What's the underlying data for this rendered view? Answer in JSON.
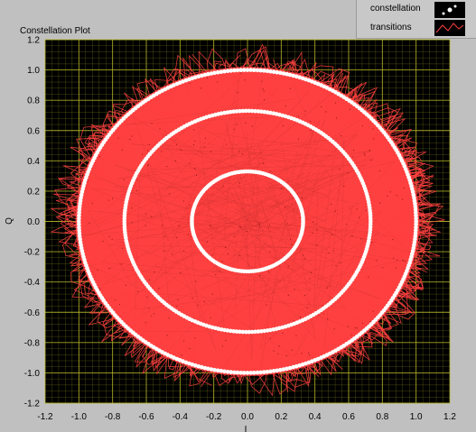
{
  "chart_data": {
    "type": "scatter",
    "title": "Constellation Plot",
    "xlabel": "I",
    "ylabel": "Q",
    "xlim": [
      -1.2,
      1.2
    ],
    "ylim": [
      -1.2,
      1.2
    ],
    "xticks": [
      "-1.2",
      "-1.0",
      "-0.8",
      "-0.6",
      "-0.4",
      "-0.2",
      "0.0",
      "0.2",
      "0.4",
      "0.6",
      "0.8",
      "1.0",
      "1.2"
    ],
    "yticks": [
      "1.2",
      "1.0",
      "0.8",
      "0.6",
      "0.4",
      "0.2",
      "0.0",
      "-0.2",
      "-0.4",
      "-0.6",
      "-0.8",
      "-1.0",
      "-1.2"
    ],
    "grid": true,
    "legend_position": "top-right",
    "series": [
      {
        "name": "constellation",
        "style": "points",
        "rings": [
          0.33,
          0.73,
          1.0
        ]
      },
      {
        "name": "transitions",
        "style": "line"
      }
    ],
    "colors": {
      "background": "#000000",
      "grid": "#b7b72a",
      "constellation": "#ffffff",
      "transitions": "#ff4040"
    }
  }
}
